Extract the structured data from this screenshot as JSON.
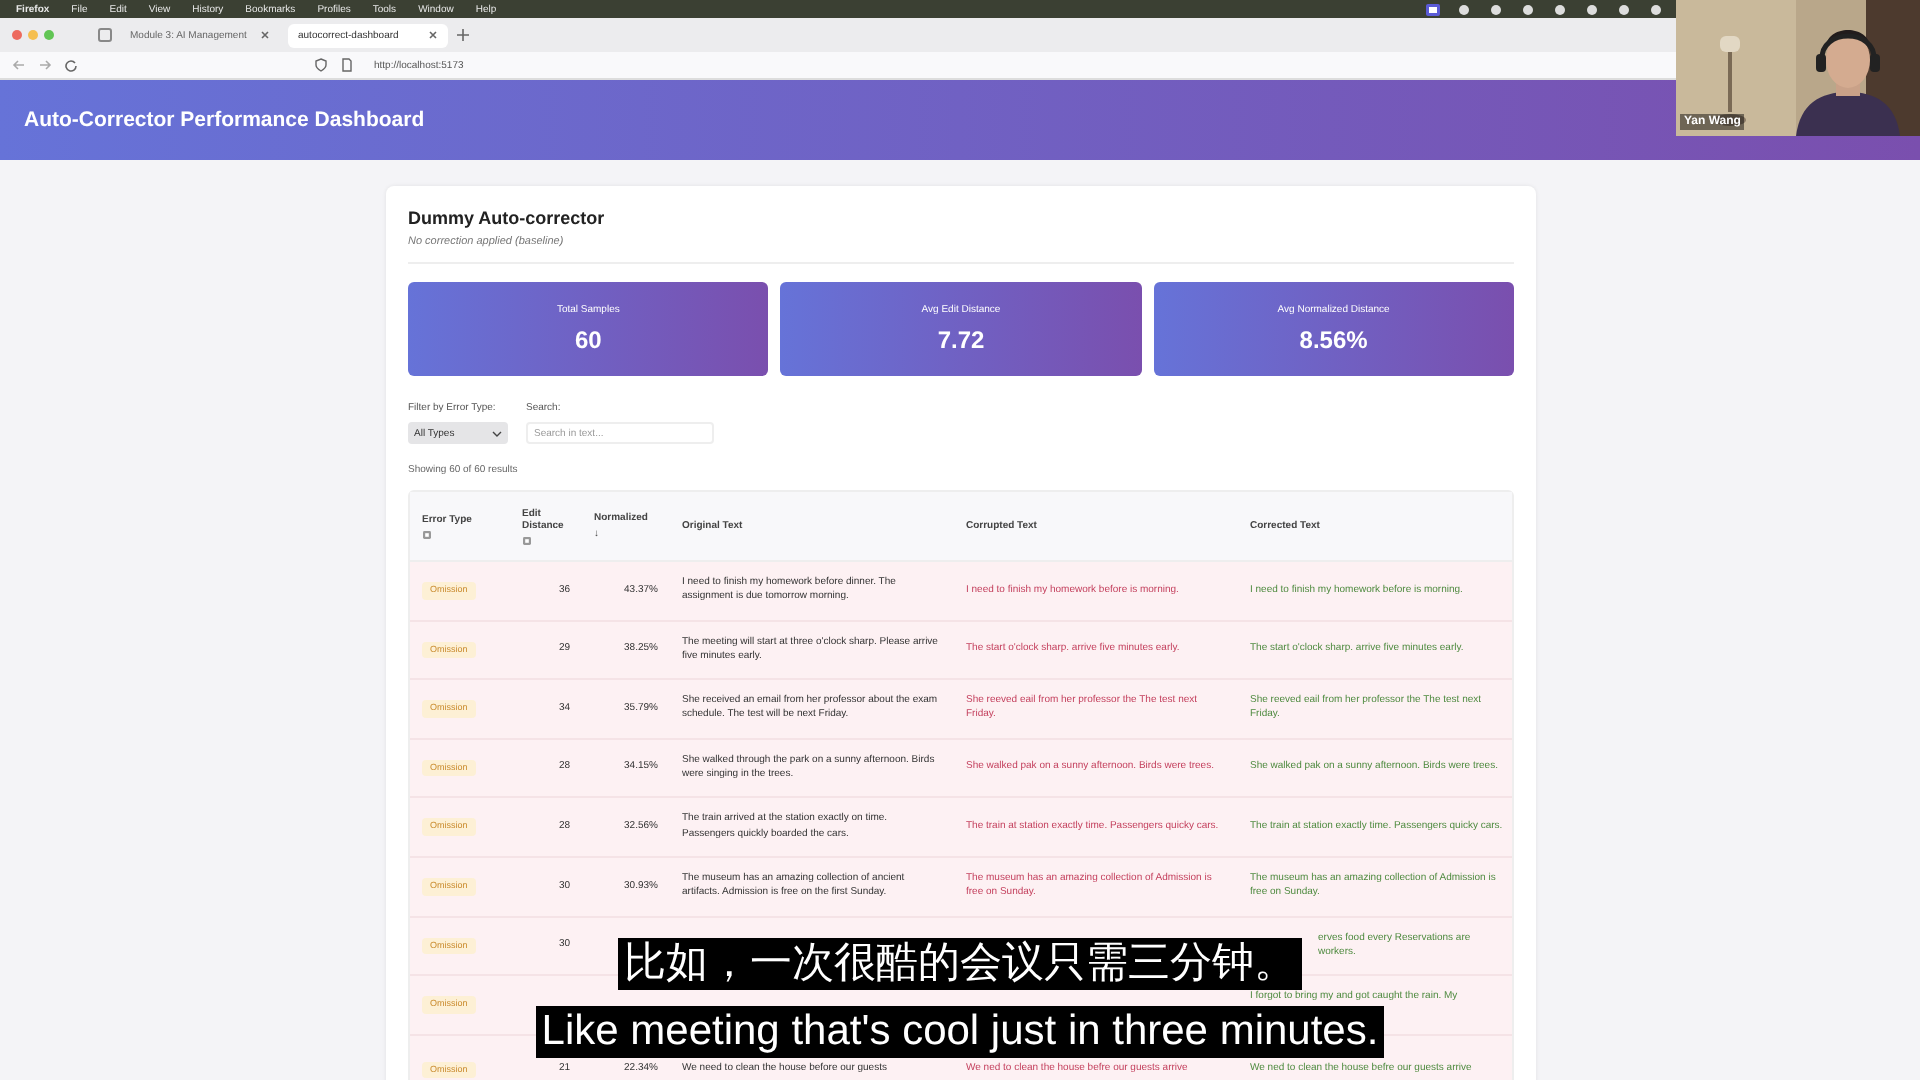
{
  "menu_bar": {
    "app": "Firefox",
    "items": [
      "File",
      "Edit",
      "View",
      "History",
      "Bookmarks",
      "Profiles",
      "Tools",
      "Window",
      "Help"
    ]
  },
  "tabs": [
    {
      "label": "Module 3: AI Management",
      "selected": false
    },
    {
      "label": "autocorrect-dashboard",
      "selected": true
    }
  ],
  "address_bar": {
    "url": "http://localhost:5173"
  },
  "header": {
    "title": "Auto-Corrector Performance Dashboard"
  },
  "video_call": {
    "participant": "Yan Wang"
  },
  "panel": {
    "title": "Dummy Auto-corrector",
    "subtitle": "No correction applied (baseline)"
  },
  "stats": [
    {
      "label": "Total Samples",
      "value": "60"
    },
    {
      "label": "Avg Edit Distance",
      "value": "7.72"
    },
    {
      "label": "Avg Normalized Distance",
      "value": "8.56%"
    }
  ],
  "filters": {
    "type_label": "Filter by Error Type:",
    "type_value": "All Types",
    "search_label": "Search:",
    "search_placeholder": "Search in text..."
  },
  "result_count": "Showing 60 of 60 results",
  "table": {
    "columns": [
      {
        "label": "Error Type",
        "info": true
      },
      {
        "label": "Edit Distance",
        "info": true
      },
      {
        "label": "Normalized",
        "info": false,
        "sort": "↓"
      },
      {
        "label": "Original Text",
        "info": false
      },
      {
        "label": "Corrupted Text",
        "info": false
      },
      {
        "label": "Corrected Text",
        "info": false
      }
    ],
    "rows": [
      {
        "error_type": "Omission",
        "edit_distance": "36",
        "normalized": "43.37%",
        "original": "I need to finish my homework before dinner. The assignment is due tomorrow morning.",
        "corrupted": "I need to finish my homework before is morning.",
        "corrected": "I need to finish my homework before is morning."
      },
      {
        "error_type": "Omission",
        "edit_distance": "29",
        "normalized": "38.25%",
        "original": "The meeting will start at three o'clock sharp. Please arrive five minutes early.",
        "corrupted": "The start o'clock sharp. arrive five minutes early.",
        "corrected": "The start o'clock sharp. arrive five minutes early."
      },
      {
        "error_type": "Omission",
        "edit_distance": "34",
        "normalized": "35.79%",
        "original": "She received an email from her professor about the exam schedule. The test will be next Friday.",
        "corrupted": "She reeved eail from her professor the The test next Friday.",
        "corrected": "She reeved eail from her professor the The test next Friday."
      },
      {
        "error_type": "Omission",
        "edit_distance": "28",
        "normalized": "34.15%",
        "original": "She walked through the park on a sunny afternoon. Birds were singing in the trees.",
        "corrupted": "She walked pak on a sunny afternoon. Birds were trees.",
        "corrected": "She walked pak on a sunny afternoon. Birds were trees."
      },
      {
        "error_type": "Omission",
        "edit_distance": "28",
        "normalized": "32.56%",
        "original": "The train arrived at the station exactly on time. Passengers quickly boarded the cars.",
        "corrupted": "The train at station exactly time. Passengers quicky cars.",
        "corrected": "The train at station exactly time. Passengers quicky cars."
      },
      {
        "error_type": "Omission",
        "edit_distance": "30",
        "normalized": "30.93%",
        "original": "The museum has an amazing collection of ancient artifacts. Admission is free on the first Sunday.",
        "corrupted": "The museum has an amazing collection of Admission is free on Sunday.",
        "corrected": "The museum has an amazing collection of Admission is free on Sunday."
      },
      {
        "error_type": "Omission",
        "edit_distance": "30",
        "corrected": "erves food every Reservations are workers."
      },
      {
        "error_type": "Omission",
        "corrected": "I forgot to bring my and got caught the rain. My"
      },
      {
        "error_type": "Omission",
        "edit_distance": "21",
        "normalized": "22.34%",
        "original": "We need to clean the house before our guests",
        "corrupted": "We ned to clean the house befre our guests arrive",
        "corrected": "We ned to clean the house befre our guests arrive"
      }
    ]
  },
  "captions": [
    "比如，一次很酷的会议只需三分钟。",
    "Like meeting that's cool just in three minutes."
  ]
}
